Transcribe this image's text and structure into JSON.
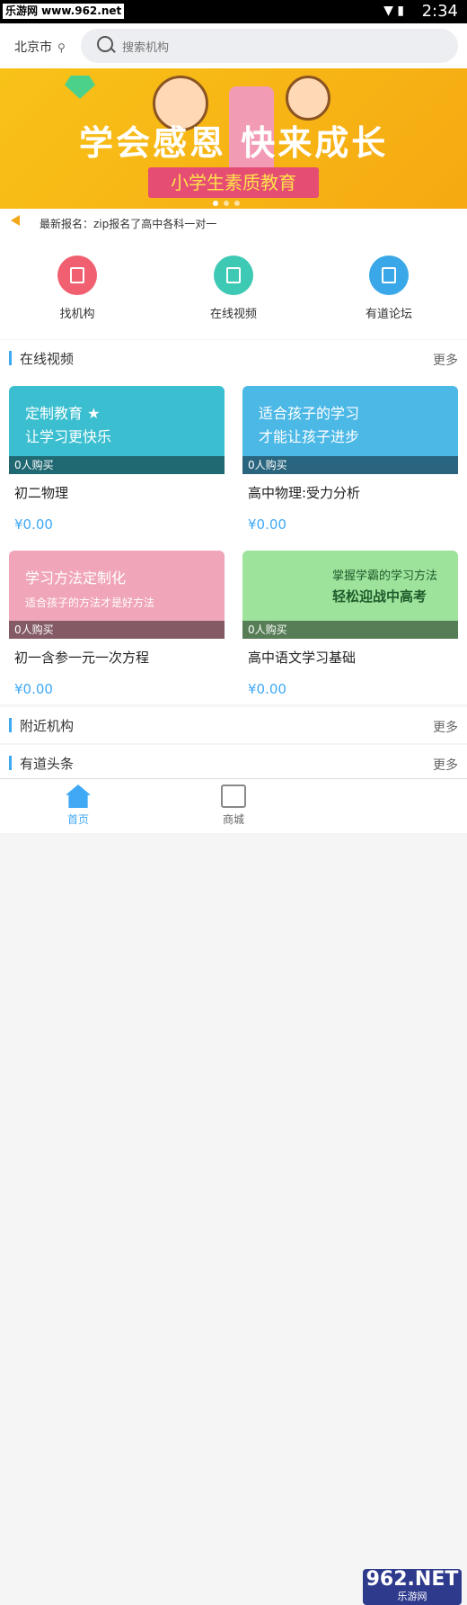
{
  "statusbar": {
    "watermark": "乐游网 www.962.net",
    "time": "2:34"
  },
  "header": {
    "city": "北京市",
    "search_placeholder": "搜索机构"
  },
  "banner": {
    "title": "学会感恩 快来成长",
    "ribbon": "小学生素质教育"
  },
  "news": {
    "text": "最新报名：zip报名了高中各科一对一"
  },
  "categories": [
    {
      "label": "找机构",
      "color": "#f06070"
    },
    {
      "label": "在线视频",
      "color": "#3ec9b4"
    },
    {
      "label": "有道论坛",
      "color": "#3aa8e8"
    }
  ],
  "sections": {
    "video": {
      "title": "在线视频",
      "more": "更多"
    },
    "nearby": {
      "title": "附近机构",
      "more": "更多"
    },
    "headlines": {
      "title": "有道头条",
      "more": "更多"
    }
  },
  "videos": [
    {
      "thumb_text": "定制教育 ★\n让学习更快乐",
      "thumb_color": "#3bbfd0",
      "buyers": "0人购买",
      "name": "初二物理",
      "price": "¥0.00"
    },
    {
      "thumb_text": "适合孩子的学习\n才能让孩子进步",
      "thumb_color": "#4cb8e6",
      "buyers": "0人购买",
      "name": "高中物理:受力分析",
      "price": "¥0.00"
    },
    {
      "thumb_text": "学习方法定制化\n适合孩子的方法才是好方法",
      "thumb_color": "#f0a6b8",
      "buyers": "0人购买",
      "name": "初一含参一元一次方程",
      "price": "¥0.00"
    },
    {
      "thumb_text": "掌握学霸的学习方法\n轻松迎战中高考",
      "thumb_color": "#9de39b",
      "buyers": "0人购买",
      "name": "高中语文学习基础",
      "price": "¥0.00"
    }
  ],
  "tabs": [
    {
      "label": "首页",
      "icon": "home-icon",
      "active": true
    },
    {
      "label": "商城",
      "icon": "shop-bag-icon",
      "active": false
    }
  ],
  "watermark2": {
    "brand": "962.NET",
    "sub": "乐游网"
  },
  "colors": {
    "accent": "#3fa9f5"
  }
}
